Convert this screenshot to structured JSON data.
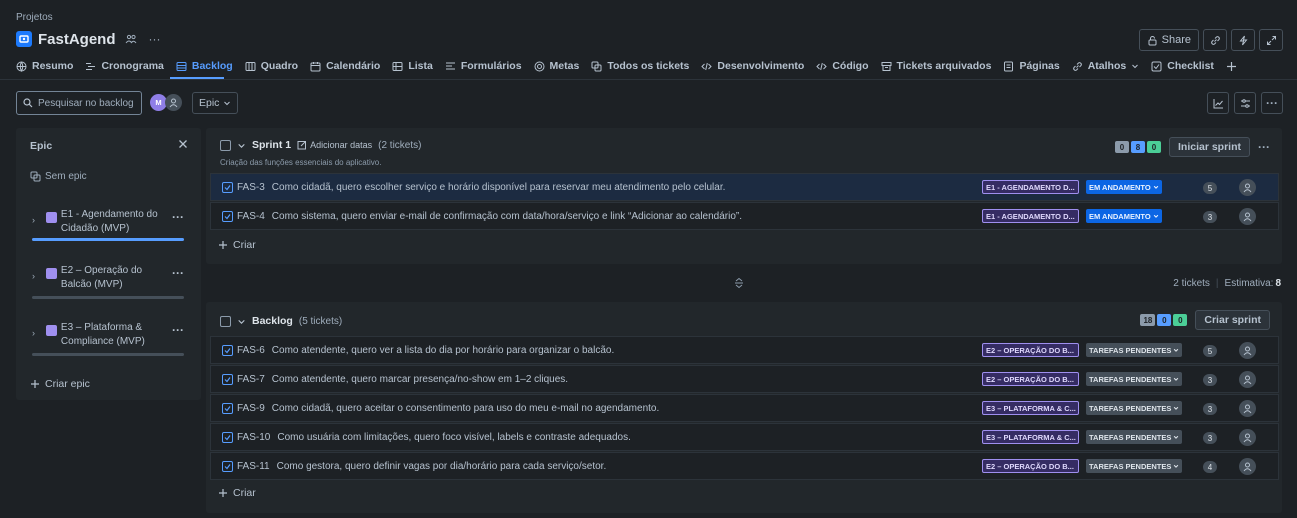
{
  "breadcrumb": "Projetos",
  "project": {
    "title": "FastAgend"
  },
  "header_actions": {
    "share_label": "Share"
  },
  "tabs": [
    {
      "label": "Resumo",
      "icon": "globe-icon"
    },
    {
      "label": "Cronograma",
      "icon": "timeline-icon"
    },
    {
      "label": "Backlog",
      "icon": "backlog-icon",
      "active": true
    },
    {
      "label": "Quadro",
      "icon": "board-icon"
    },
    {
      "label": "Calendário",
      "icon": "calendar-icon"
    },
    {
      "label": "Lista",
      "icon": "list-icon"
    },
    {
      "label": "Formulários",
      "icon": "forms-icon"
    },
    {
      "label": "Metas",
      "icon": "target-icon"
    },
    {
      "label": "Todos os tickets",
      "icon": "tickets-icon"
    },
    {
      "label": "Desenvolvimento",
      "icon": "code-icon"
    },
    {
      "label": "Código",
      "icon": "code-icon"
    },
    {
      "label": "Tickets arquivados",
      "icon": "archive-icon"
    },
    {
      "label": "Páginas",
      "icon": "pages-icon"
    },
    {
      "label": "Atalhos",
      "icon": "link-icon",
      "dropdown": true
    },
    {
      "label": "Checklist",
      "icon": "checklist-icon"
    }
  ],
  "toolbar": {
    "search_placeholder": "Pesquisar no backlog",
    "avatar_initial": "M",
    "epic_filter_label": "Epic"
  },
  "epic_panel": {
    "title": "Epic",
    "no_epic_label": "Sem epic",
    "epics": [
      {
        "label": "E1 - Agendamento do Cidadão (MVP)",
        "progress_active": true
      },
      {
        "label": "E2 – Operação do Balcão (MVP)",
        "progress_active": false
      },
      {
        "label": "E3 – Plataforma & Compliance (MVP)",
        "progress_active": false
      }
    ],
    "create_label": "Criar epic"
  },
  "sprint": {
    "title": "Sprint 1",
    "add_dates_label": "Adicionar datas",
    "count_label": "(2 tickets)",
    "goal": "Criação das funções essenciais do aplicativo.",
    "counts": {
      "todo": "0",
      "in_progress": "8",
      "done": "0"
    },
    "action_label": "Iniciar sprint",
    "issues": [
      {
        "key": "FAS-3",
        "summary": "Como cidadã, quero escolher serviço e horário disponível para reservar meu atendimento pelo celular.",
        "epic": "E1 - AGENDAMENTO D...",
        "status": "EM ANDAMENTO",
        "status_type": "prog",
        "points": "5",
        "selected": true
      },
      {
        "key": "FAS-4",
        "summary": "Como sistema, quero enviar e-mail de confirmação com data/hora/serviço e link “Adicionar ao calendário”.",
        "epic": "E1 - AGENDAMENTO D...",
        "status": "EM ANDAMENTO",
        "status_type": "prog",
        "points": "3",
        "selected": false
      }
    ],
    "create_label": "Criar"
  },
  "sprint_footer": {
    "tickets": "2 tickets",
    "estimate_label": "Estimativa:",
    "estimate_value": "8"
  },
  "backlog": {
    "title": "Backlog",
    "count_label": "(5 tickets)",
    "counts": {
      "todo": "18",
      "in_progress": "0",
      "done": "0"
    },
    "action_label": "Criar sprint",
    "issues": [
      {
        "key": "FAS-6",
        "summary": "Como atendente, quero ver a lista do dia por horário para organizar o balcão.",
        "epic": "E2 – OPERAÇÃO DO B...",
        "status": "TAREFAS PENDENTES",
        "status_type": "todo",
        "points": "5"
      },
      {
        "key": "FAS-7",
        "summary": "Como atendente, quero marcar presença/no-show em 1–2 cliques.",
        "epic": "E2 – OPERAÇÃO DO B...",
        "status": "TAREFAS PENDENTES",
        "status_type": "todo",
        "points": "3"
      },
      {
        "key": "FAS-9",
        "summary": "Como cidadã, quero aceitar o consentimento para uso do meu e-mail no agendamento.",
        "epic": "E3 – PLATAFORMA & C...",
        "status": "TAREFAS PENDENTES",
        "status_type": "todo",
        "points": "3"
      },
      {
        "key": "FAS-10",
        "summary": "Como usuária com limitações, quero foco visível, labels e contraste adequados.",
        "epic": "E3 – PLATAFORMA & C...",
        "status": "TAREFAS PENDENTES",
        "status_type": "todo",
        "points": "3"
      },
      {
        "key": "FAS-11",
        "summary": "Como gestora, quero definir vagas por dia/horário para cada serviço/setor.",
        "epic": "E2 – OPERAÇÃO DO B...",
        "status": "TAREFAS PENDENTES",
        "status_type": "todo",
        "points": "4"
      }
    ],
    "create_label": "Criar"
  },
  "colors": {
    "accent": "#579dff",
    "epic": "#9f8fef",
    "in_progress": "#0c66e4",
    "background": "#1d2125"
  }
}
